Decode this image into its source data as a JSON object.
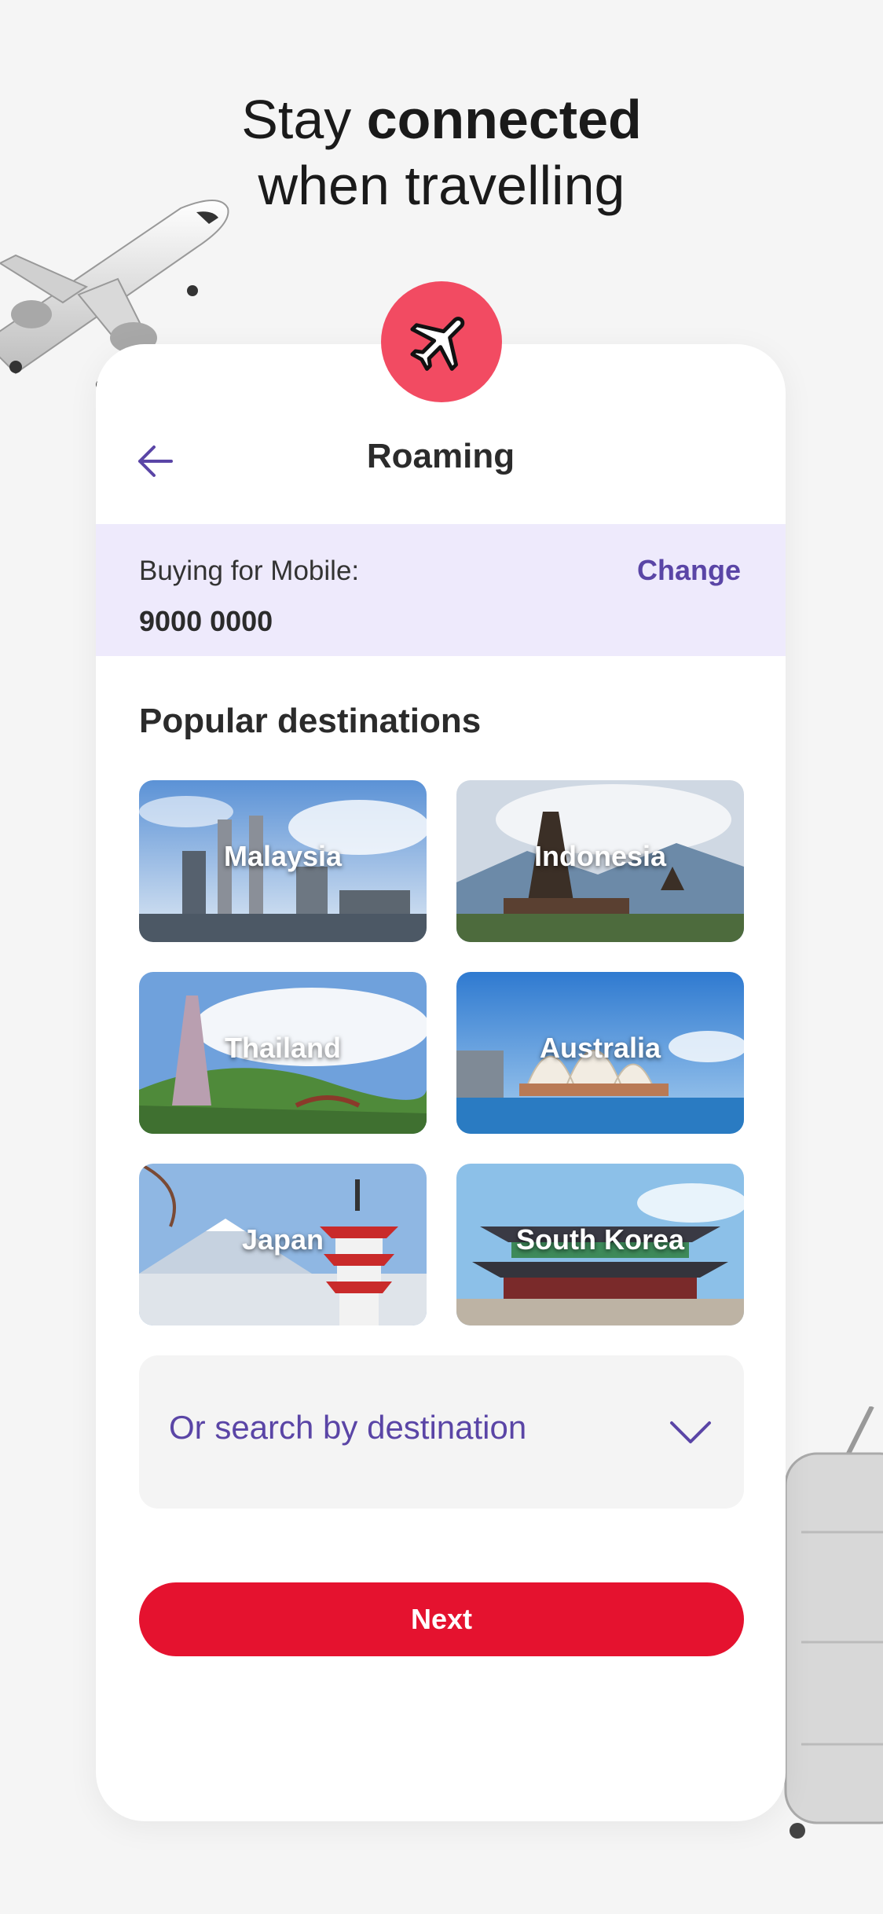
{
  "headline": {
    "prefix": "Stay ",
    "bold": "connected",
    "line2": "when travelling"
  },
  "screen": {
    "title": "Roaming"
  },
  "buying": {
    "label": "Buying for Mobile:",
    "number": "9000 0000",
    "change_label": "Change"
  },
  "destinations": {
    "title": "Popular destinations",
    "items": [
      {
        "name": "Malaysia"
      },
      {
        "name": "Indonesia"
      },
      {
        "name": "Thailand"
      },
      {
        "name": "Australia"
      },
      {
        "name": "Japan"
      },
      {
        "name": "South Korea"
      }
    ]
  },
  "search": {
    "placeholder": "Or search by destination"
  },
  "next_label": "Next",
  "colors": {
    "accent": "#5a45a6",
    "primary_button": "#e5122f",
    "fab": "#f24b62",
    "buying_bg": "#eeeafc"
  },
  "icons": [
    "airplane-icon",
    "back-arrow-icon",
    "chevron-down-icon"
  ]
}
